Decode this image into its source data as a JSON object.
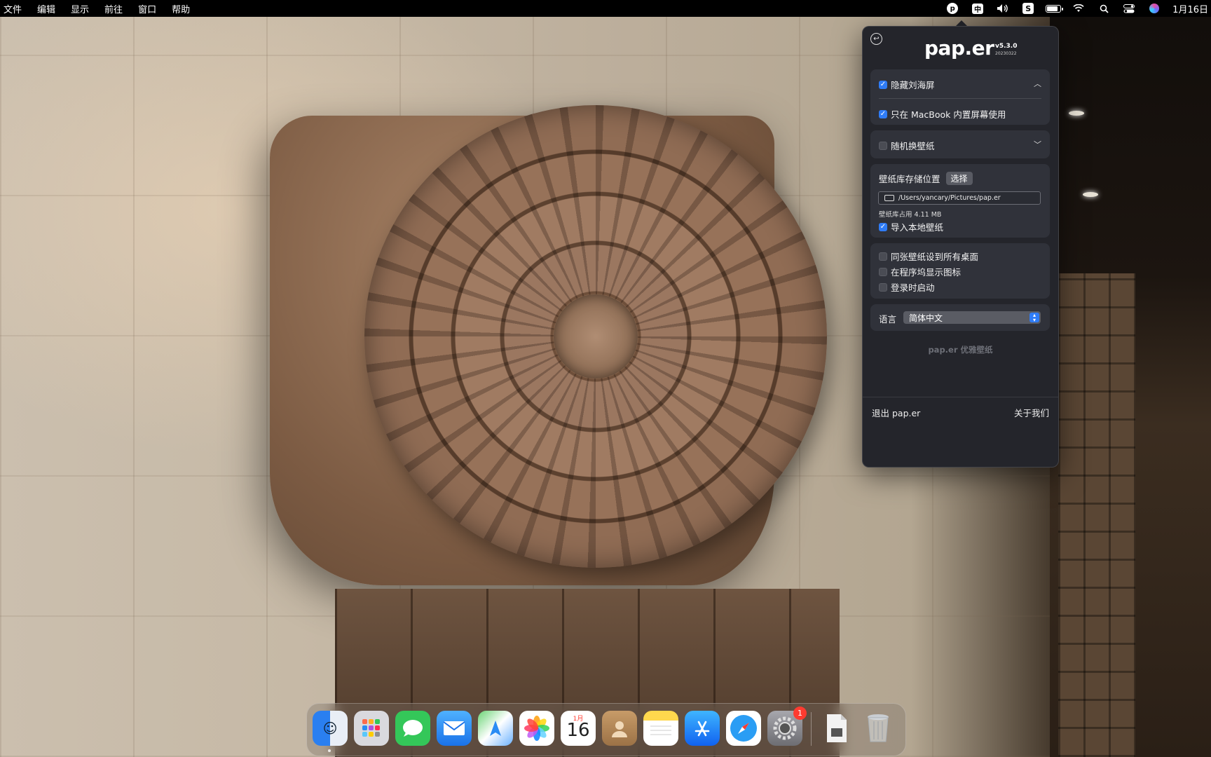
{
  "menubar": {
    "items": [
      "文件",
      "编辑",
      "显示",
      "前往",
      "窗口",
      "帮助"
    ],
    "status_icons": [
      "paper-icon",
      "input-method-icon",
      "volume-icon",
      "s-app-icon",
      "battery-icon",
      "wifi-icon",
      "spotlight-icon",
      "control-center-icon",
      "siri-icon"
    ],
    "ime_label": "中",
    "paper_label": "p",
    "s_label": "S",
    "clock": "1月16日"
  },
  "popover": {
    "brand": "pap.er",
    "version": "v5.3.0",
    "build": "20230322",
    "hide_notch": {
      "label": "隐藏刘海屏",
      "checked": true
    },
    "builtin_only": {
      "label": "只在 MacBook 内置屏幕使用",
      "checked": true
    },
    "random_wallpaper": {
      "label": "随机换壁纸",
      "checked": false
    },
    "storage": {
      "label": "壁纸库存储位置",
      "choose_label": "选择",
      "path": "/Users/yancary/Pictures/pap.er",
      "usage": "壁纸库占用 4.11 MB"
    },
    "import_local": {
      "label": "导入本地壁纸",
      "checked": true
    },
    "same_all_desktops": {
      "label": "同张壁纸设到所有桌面",
      "checked": false
    },
    "show_dock_icon": {
      "label": "在程序坞显示图标",
      "checked": false
    },
    "launch_at_login": {
      "label": "登录时启动",
      "checked": false
    },
    "language": {
      "label": "语言",
      "selected": "简体中文"
    },
    "tagline": "pap.er 优雅壁纸",
    "quit_label": "退出 pap.er",
    "about_label": "关于我们"
  },
  "dock": {
    "apps": [
      {
        "name": "Finder",
        "icon": "finder-icon",
        "color": "#3d8ef0"
      },
      {
        "name": "Launchpad",
        "icon": "launchpad-icon",
        "color": "#d9d9dd"
      },
      {
        "name": "Messages",
        "icon": "messages-icon",
        "color": "#34c759"
      },
      {
        "name": "Mail",
        "icon": "mail-icon",
        "color": "#2a8cf4"
      },
      {
        "name": "Maps",
        "icon": "maps-icon",
        "color": "#5ac46b"
      },
      {
        "name": "Photos",
        "icon": "photos-icon",
        "color": "#ffffff"
      },
      {
        "name": "Calendar",
        "icon": "calendar-icon",
        "color": "#ffffff"
      },
      {
        "name": "Contacts",
        "icon": "contacts-icon",
        "color": "#b58b5a"
      },
      {
        "name": "Notes",
        "icon": "notes-icon",
        "color": "#ffd84d"
      },
      {
        "name": "App Store",
        "icon": "app-store-icon",
        "color": "#1d8cf8"
      },
      {
        "name": "Safari",
        "icon": "safari-icon",
        "color": "#2a9df4"
      },
      {
        "name": "System Settings",
        "icon": "system-settings-icon",
        "color": "#8e8e93"
      }
    ],
    "calendar_month": "1月",
    "calendar_day": "16",
    "settings_badge": "1"
  }
}
